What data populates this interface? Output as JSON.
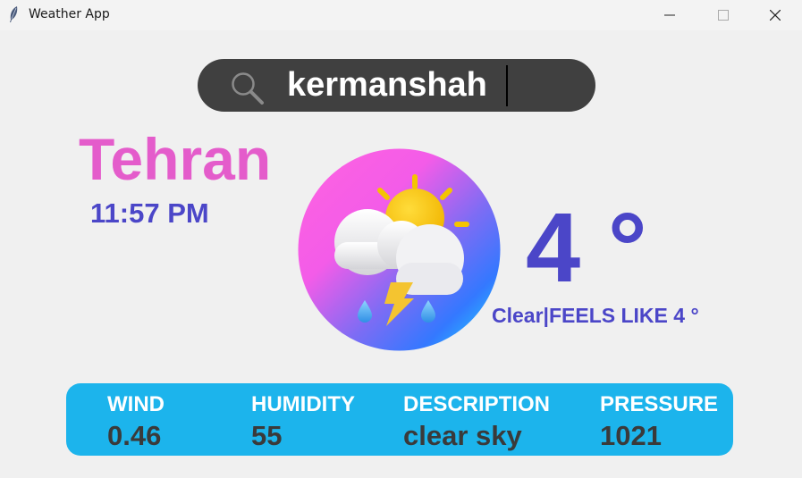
{
  "window": {
    "title": "Weather App",
    "icon": "feather-icon"
  },
  "search": {
    "value": "kermanshah",
    "icon": "search-icon"
  },
  "location": {
    "city": "Tehran",
    "time": "11:57 PM"
  },
  "weather_logo": {
    "icon": "thunderstorm-cloud-sun-icon"
  },
  "current": {
    "temperature": "4 °",
    "condition_line": "Clear|FEELS LIKE 4 °"
  },
  "details": {
    "wind": {
      "label": "WIND",
      "value": "0.46"
    },
    "humidity": {
      "label": "HUMIDITY",
      "value": "55"
    },
    "description": {
      "label": "DESCRIPTION",
      "value": "clear sky"
    },
    "pressure": {
      "label": "PRESSURE",
      "value": "1021"
    }
  },
  "colors": {
    "city": "#e45ccb",
    "accent": "#4b46c8",
    "search_bg": "#404040",
    "info_bar": "#1cb4ec"
  }
}
